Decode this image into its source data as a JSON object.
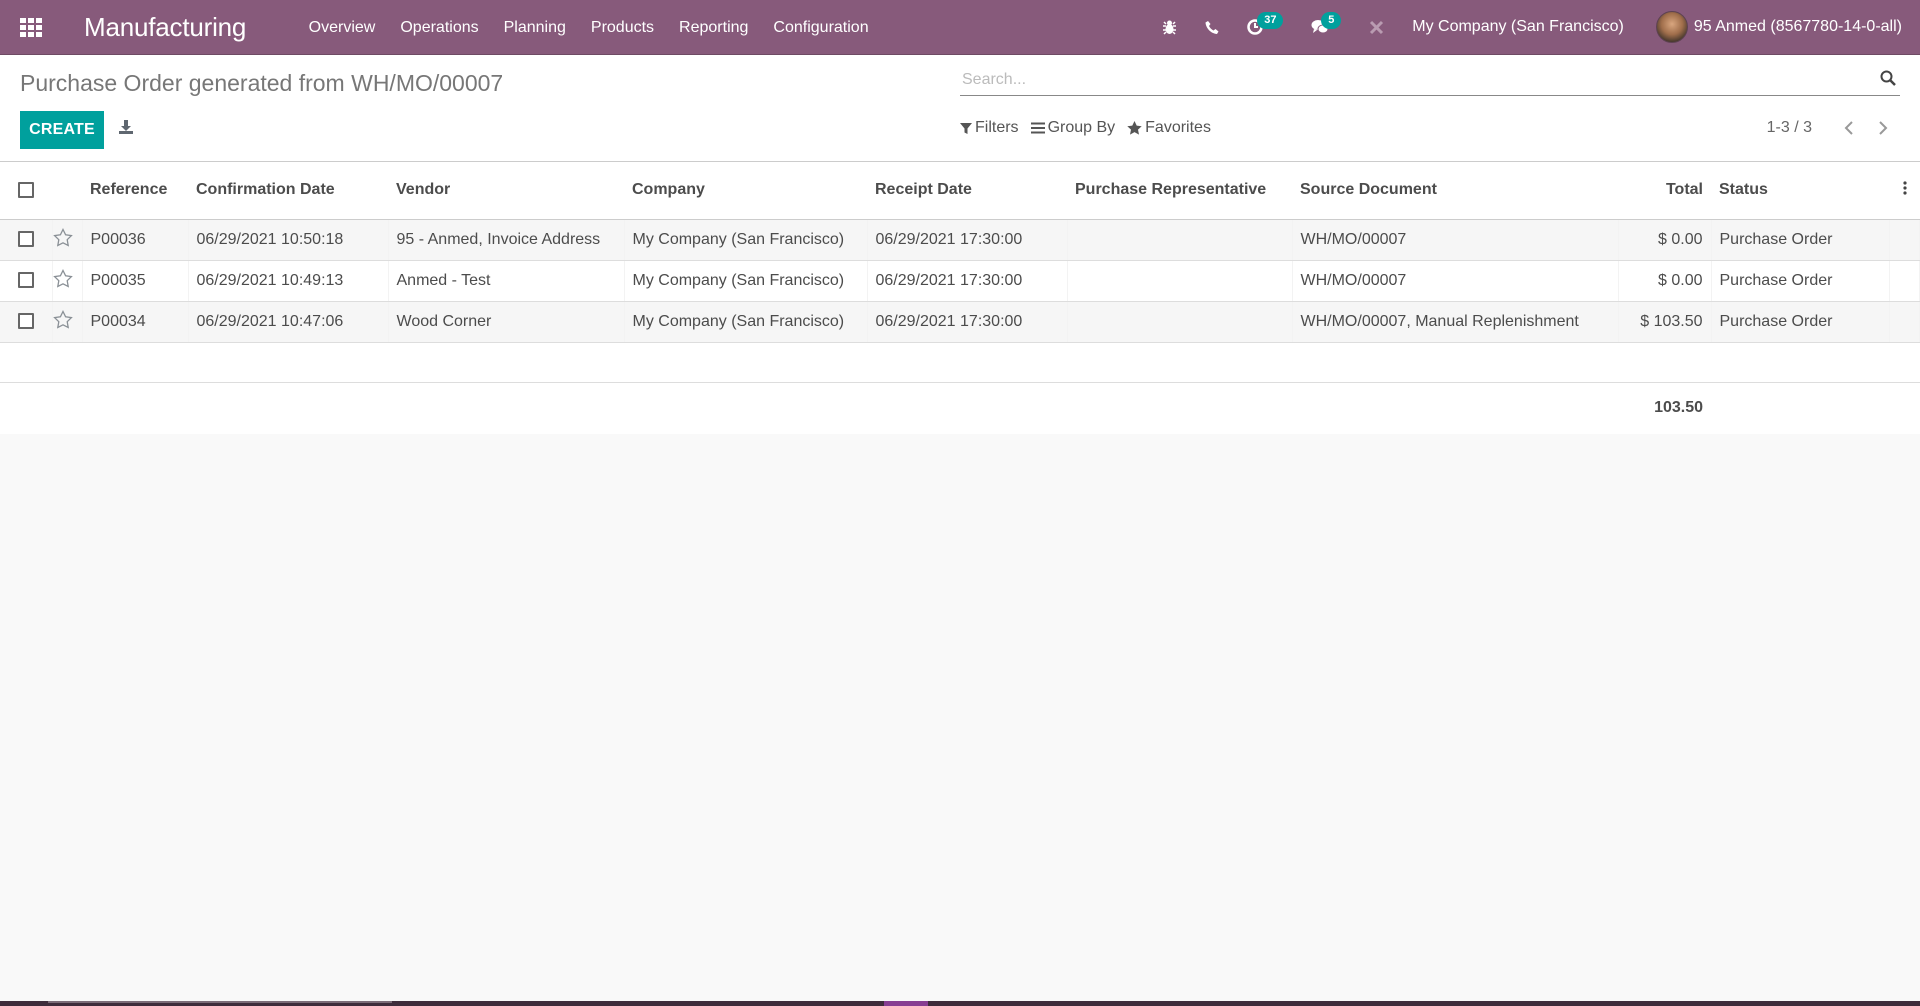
{
  "navbar": {
    "app_name": "Manufacturing",
    "menu": [
      "Overview",
      "Operations",
      "Planning",
      "Products",
      "Reporting",
      "Configuration"
    ],
    "activity_count": "37",
    "message_count": "5",
    "company": "My Company (San Francisco)",
    "user": "95 Anmed (8567780-14-0-all)",
    "color": "#875a7b"
  },
  "control_panel": {
    "title": "Purchase Order generated from WH/MO/00007",
    "create_label": "CREATE",
    "search_placeholder": "Search...",
    "filters_label": "Filters",
    "group_by_label": "Group By",
    "favorites_label": "Favorites",
    "pager": "1-3 / 3",
    "accent": "#00a09d"
  },
  "table": {
    "columns": [
      "Reference",
      "Confirmation Date",
      "Vendor",
      "Company",
      "Receipt Date",
      "Purchase Representative",
      "Source Document",
      "Total",
      "Status"
    ],
    "rows": [
      {
        "reference": "P00036",
        "confirmation_date": "06/29/2021 10:50:18",
        "vendor": "95 - Anmed, Invoice Address",
        "company": "My Company (San Francisco)",
        "receipt_date": "06/29/2021 17:30:00",
        "representative": "",
        "source": "WH/MO/00007",
        "total": "$ 0.00",
        "status": "Purchase Order"
      },
      {
        "reference": "P00035",
        "confirmation_date": "06/29/2021 10:49:13",
        "vendor": "Anmed - Test",
        "company": "My Company (San Francisco)",
        "receipt_date": "06/29/2021 17:30:00",
        "representative": "",
        "source": "WH/MO/00007",
        "total": "$ 0.00",
        "status": "Purchase Order"
      },
      {
        "reference": "P00034",
        "confirmation_date": "06/29/2021 10:47:06",
        "vendor": "Wood Corner",
        "company": "My Company (San Francisco)",
        "receipt_date": "06/29/2021 17:30:00",
        "representative": "",
        "source": "WH/MO/00007, Manual Replenishment",
        "total": "$ 103.50",
        "status": "Purchase Order"
      }
    ],
    "total_sum": "103.50"
  }
}
